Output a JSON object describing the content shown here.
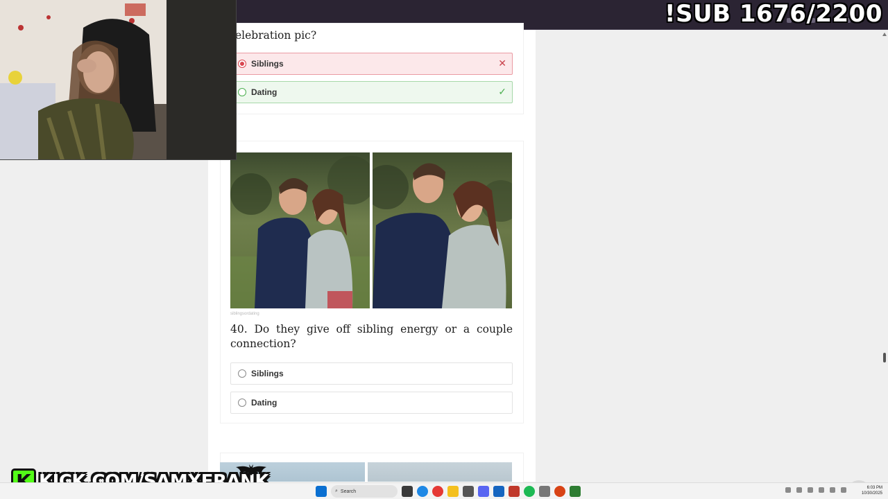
{
  "overlay": {
    "sub_counter": "!SUB 1676/2200",
    "kick_url": "KICK.COM/SAMXFRANK",
    "kick_logo_letter": "K"
  },
  "previous_question": {
    "title_fragment": "elebration pic?",
    "options": [
      {
        "label": "Siblings",
        "state": "selected-wrong",
        "mark": "close-icon"
      },
      {
        "label": "Dating",
        "state": "correct",
        "mark": "check-icon"
      }
    ]
  },
  "current_question": {
    "title": "40. Do they give off sibling energy or a couple connection?",
    "image_credit": "siblingsordating",
    "options": [
      {
        "label": "Siblings"
      },
      {
        "label": "Dating"
      }
    ]
  },
  "taskbar": {
    "search_placeholder": "Search",
    "clock_time": "6:03 PM",
    "clock_date": "10/30/2025"
  },
  "colors": {
    "wrong_bg": "#fce8ea",
    "wrong_accent": "#d9454f",
    "correct_bg": "#eef8ee",
    "correct_accent": "#4caf50",
    "kick_green": "#53fc18",
    "browser_bar": "#2b2433"
  },
  "icons": {
    "scroll_top": "chevron-up-icon",
    "webcam": "webcam-feed",
    "kick_logo": "kick-logo-icon",
    "bat": "bat-icon"
  }
}
